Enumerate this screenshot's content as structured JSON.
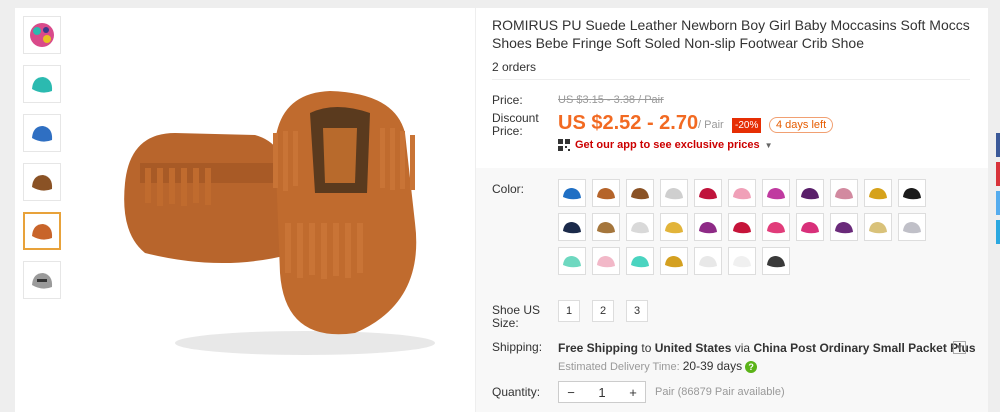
{
  "product": {
    "title": "ROMIRUS PU Suede Leather Newborn Boy Girl Baby Moccasins Soft Moccs Shoes Bebe Fringe Soft Soled Non-slip Footwear Crib Shoe",
    "orders": "2 orders"
  },
  "price": {
    "label": "Price:",
    "original": "US $3.15 - 3.38 / Pair",
    "discount_label": "Discount Price:",
    "sale": "US $2.52 - 2.70",
    "per_unit": "/ Pair",
    "discount_badge": "-20%",
    "days_left": "4 days left",
    "app_promo": "Get our app to see exclusive prices"
  },
  "options": {
    "color_label": "Color:",
    "colors": [
      "#1f6fc4",
      "#b5642a",
      "#8a5225",
      "#cfcfcf",
      "#c0143c",
      "#f0a0b8",
      "#c03aa0",
      "#5a1f6a",
      "#d28aa0",
      "#d6a21a",
      "#1b1b1b",
      "#1b2a4a",
      "#a5763c",
      "#d9d9d9",
      "#e2b43a",
      "#8e2a86",
      "#c6143a",
      "#e13c7a",
      "#d8307a",
      "#6a2a7a",
      "#d9c27a",
      "#c0c0c8",
      "#6ed8c0",
      "#f2b8c8",
      "#4ad4c0",
      "#d4a020",
      "#e8e8e8",
      "#f0f0f0",
      "#3a3a3a"
    ],
    "size_label": "Shoe US Size:",
    "sizes": [
      "1",
      "2",
      "3"
    ]
  },
  "shipping": {
    "label": "Shipping:",
    "free": "Free Shipping",
    "to": "to",
    "country": "United States",
    "via": "via",
    "method": "China Post Ordinary Small Packet Plus",
    "est_label": "Estimated Delivery Time:",
    "est_days": "20-39 days"
  },
  "quantity": {
    "label": "Quantity:",
    "value": "1",
    "minus": "−",
    "plus": "+",
    "available": "Pair (86879 Pair available)"
  },
  "gallery": {
    "thumb_colors": [
      "#d94a8a",
      "#2bbab0",
      "#2f6fc2",
      "#8a5225",
      "#c8642a",
      "#9a9a9a"
    ],
    "active_index": 4,
    "main_color": "#b9652c"
  },
  "side_tabs": [
    "#3b5998",
    "#d8333a",
    "#55acee",
    "#2ba8e0"
  ]
}
